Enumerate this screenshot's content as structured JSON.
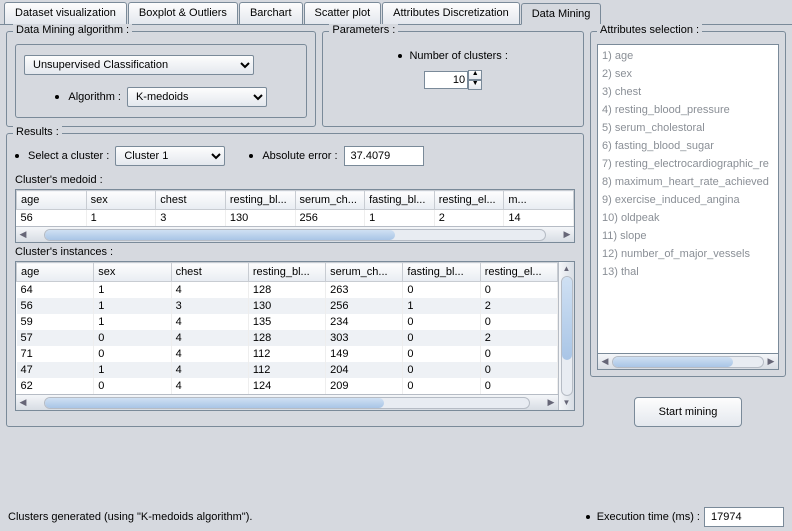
{
  "tabs": [
    "Dataset visualization",
    "Boxplot & Outliers",
    "Barchart",
    "Scatter plot",
    "Attributes Discretization",
    "Data Mining"
  ],
  "active_tab": 5,
  "algo": {
    "group_label": "Data Mining algorithm :",
    "classification": "Unsupervised Classification",
    "algo_label": "Algorithm :",
    "algo_value": "K-medoids"
  },
  "params": {
    "group_label": "Parameters :",
    "nclusters_label": "Number of clusters :",
    "nclusters_value": "10"
  },
  "results": {
    "group_label": "Results :",
    "select_label": "Select a cluster :",
    "cluster_value": "Cluster 1",
    "abs_label": "Absolute error :",
    "abs_value": "37.4079",
    "medoid_label": "Cluster's medoid :",
    "instances_label": "Cluster's instances :",
    "columns": [
      "age",
      "sex",
      "chest",
      "resting_bl...",
      "serum_ch...",
      "fasting_bl...",
      "resting_el...",
      "m..."
    ],
    "medoid_row": [
      "56",
      "1",
      "3",
      "130",
      "256",
      "1",
      "2",
      "14"
    ],
    "instance_rows": [
      [
        "64",
        "1",
        "4",
        "128",
        "263",
        "0",
        "0"
      ],
      [
        "56",
        "1",
        "3",
        "130",
        "256",
        "1",
        "2"
      ],
      [
        "59",
        "1",
        "4",
        "135",
        "234",
        "0",
        "0"
      ],
      [
        "57",
        "0",
        "4",
        "128",
        "303",
        "0",
        "2"
      ],
      [
        "71",
        "0",
        "4",
        "112",
        "149",
        "0",
        "0"
      ],
      [
        "47",
        "1",
        "4",
        "112",
        "204",
        "0",
        "0"
      ],
      [
        "62",
        "0",
        "4",
        "124",
        "209",
        "0",
        "0"
      ]
    ]
  },
  "attrs": {
    "group_label": "Attributes selection :",
    "items": [
      "age",
      "sex",
      "chest",
      "resting_blood_pressure",
      "serum_cholestoral",
      "fasting_blood_sugar",
      "resting_electrocardiographic_re",
      "maximum_heart_rate_achieved",
      "exercise_induced_angina",
      "oldpeak",
      "slope",
      "number_of_major_vessels",
      "thal"
    ]
  },
  "start_label": "Start mining",
  "footer_status": "Clusters generated (using \"K-medoids algorithm\").",
  "exec_label": "Execution time (ms) :",
  "exec_value": "17974"
}
